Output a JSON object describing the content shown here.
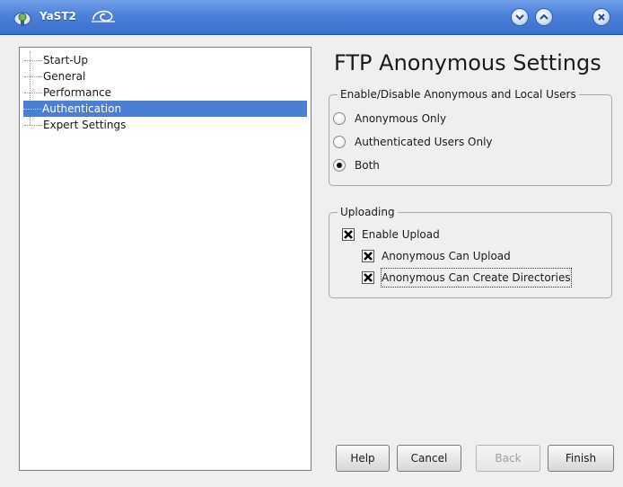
{
  "window": {
    "title": "YaST2"
  },
  "tree": {
    "items": [
      {
        "label": "Start-Up",
        "selected": false
      },
      {
        "label": "General",
        "selected": false
      },
      {
        "label": "Performance",
        "selected": false
      },
      {
        "label": "Authentication",
        "selected": true
      },
      {
        "label": "Expert Settings",
        "selected": false
      }
    ]
  },
  "page": {
    "title": "FTP Anonymous Settings"
  },
  "auth_group": {
    "legend": "Enable/Disable Anonymous and Local Users",
    "options": [
      {
        "label": "Anonymous Only",
        "checked": false
      },
      {
        "label": "Authenticated Users Only",
        "checked": false
      },
      {
        "label": "Both",
        "checked": true
      }
    ]
  },
  "upload_group": {
    "legend": "Uploading",
    "enable_upload": {
      "label": "Enable Upload",
      "checked": true
    },
    "anon_upload": {
      "label": "Anonymous Can Upload",
      "checked": true
    },
    "anon_mkdir": {
      "label": "Anonymous Can Create Directories",
      "checked": true
    }
  },
  "buttons": {
    "help": "Help",
    "cancel": "Cancel",
    "back": "Back",
    "finish": "Finish"
  },
  "colors": {
    "titlebar": "#4c80d9",
    "selection": "#4a7fd6"
  }
}
